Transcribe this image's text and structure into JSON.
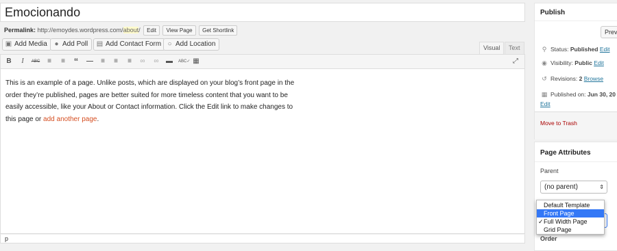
{
  "editor": {
    "title": "Emocionando",
    "permalink_label": "Permalink:",
    "permalink_base": "http://emoydes.wordpress.com/",
    "permalink_slug": "about",
    "permalink_trail": "/",
    "permalink_buttons": {
      "edit": "Edit",
      "view": "View Page",
      "shortlink": "Get Shortlink"
    },
    "media_buttons": {
      "add_media": "Add Media",
      "add_poll": "Add Poll",
      "add_contact_form": "Add Contact Form",
      "add_location": "Add Location"
    },
    "tabs": {
      "visual": "Visual",
      "text": "Text"
    },
    "toolbar_icons": [
      "bold-icon",
      "italic-icon",
      "strikethrough-icon",
      "bullet-list-icon",
      "numbered-list-icon",
      "blockquote-icon",
      "horizontal-rule-icon",
      "align-left-icon",
      "align-center-icon",
      "align-right-icon",
      "link-icon",
      "unlink-icon",
      "read-more-icon",
      "spellcheck-icon",
      "toolbar-toggle-icon",
      "fullscreen-icon"
    ],
    "content": {
      "line1": "This is an example of a page. Unlike posts, which are displayed on your blog’s front page in the",
      "line2": "order they’re published, pages are better suited for more timeless content that you want to be",
      "line3": "easily accessible, like your About or Contact information. Click the Edit link to make changes to",
      "line4_prefix": "this page or ",
      "link_text": "add another page",
      "line4_suffix": "."
    },
    "path_label": "p"
  },
  "publish": {
    "heading": "Publish",
    "preview": "Prev",
    "status_label": "Status:",
    "status_value": "Published",
    "visibility_label": "Visibility:",
    "visibility_value": "Public",
    "edit": "Edit",
    "revisions_label": "Revisions:",
    "revisions_value": "2",
    "browse": "Browse",
    "published_label": "Published on:",
    "published_value": "Jun 30, 20",
    "trash": "Move to Trash"
  },
  "page_attributes": {
    "heading": "Page Attributes",
    "parent_label": "Parent",
    "parent_value": "(no parent)",
    "order_label": "Order",
    "template_options": [
      "Default Template",
      "Front Page",
      "Full Width Page",
      "Grid Page"
    ],
    "template_highlighted": "Front Page",
    "template_checked": "Full Width Page"
  },
  "colors": {
    "link": "#21759b",
    "trash": "#a00",
    "content_link": "#d54e21",
    "menu_highlight": "#3478f6"
  }
}
